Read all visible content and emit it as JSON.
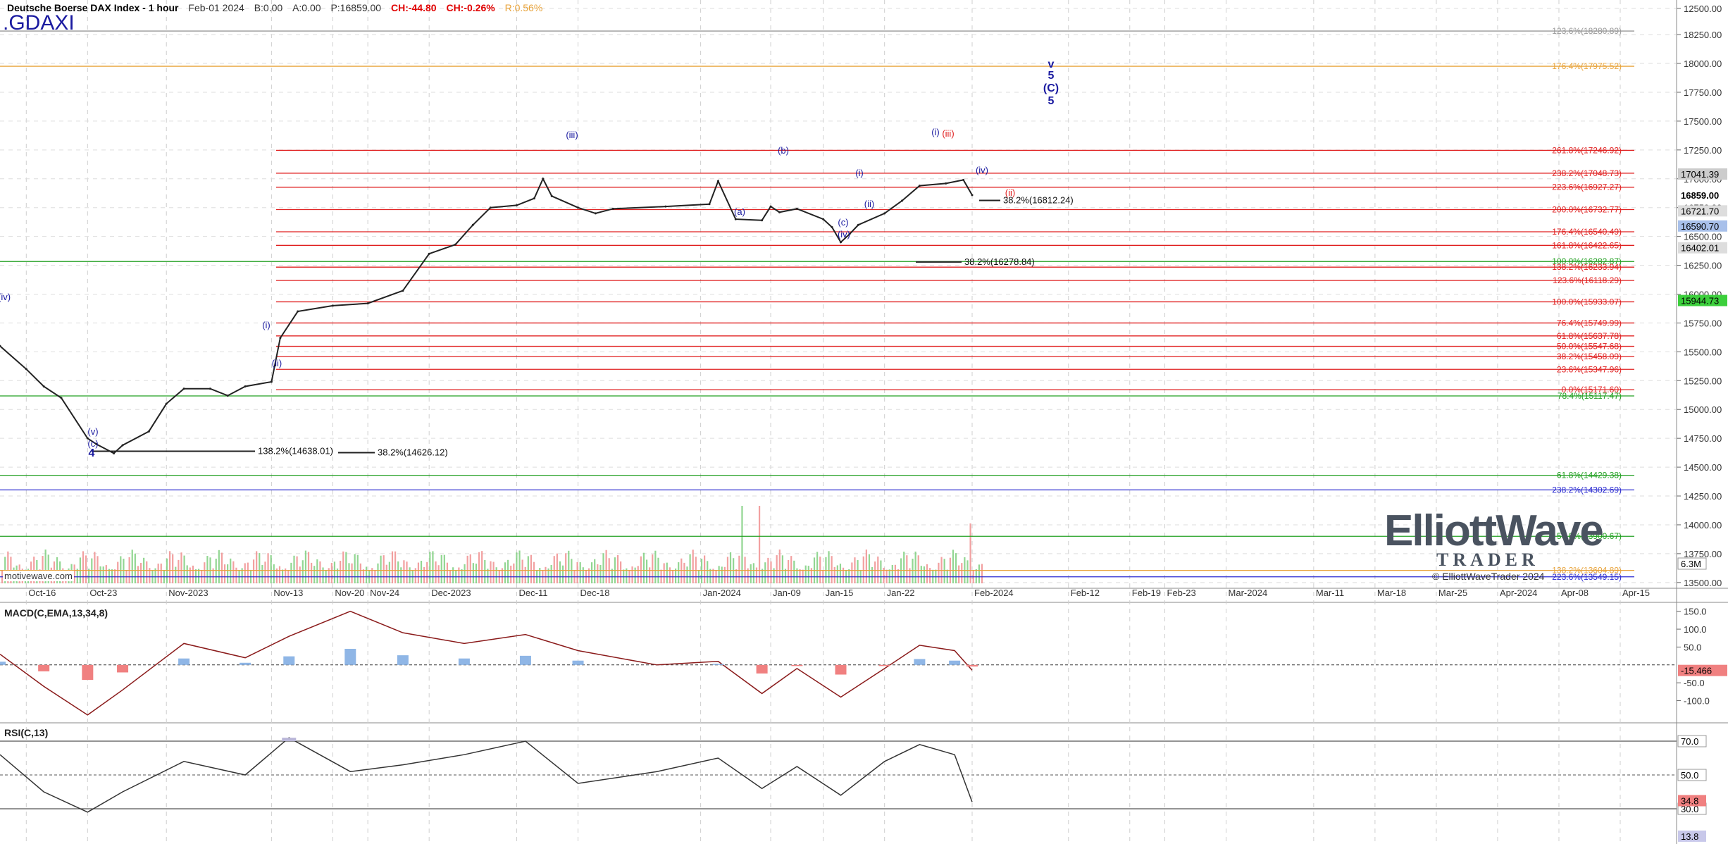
{
  "header": {
    "title": "Deutsche Boerse DAX Index - 1 hour",
    "date": "Feb-01 2024",
    "bid": "B:0.00",
    "ask": "A:0.00",
    "price": "P:16859.00",
    "change": "CH:-44.80",
    "change_pct": "CH:-0.26%",
    "range": "R:0.56%",
    "symbol": ".GDAXI",
    "brand": "motivewave.com"
  },
  "logo": {
    "main": "ElliottWave",
    "sub": "TRADER",
    "copyright": "© ElliottWaveTrader 2024"
  },
  "colors": {
    "up_price": "#222222",
    "fib_red": "#e02020",
    "fib_green": "#22a022",
    "fib_blue": "#2a2ad0",
    "fib_orange": "#e8a33a",
    "volume_green": "#7fcf7f",
    "volume_red": "#f08f8f",
    "macd_hist_blue": "#8fb6e6",
    "macd_hist_red": "#f08080",
    "rsi_fill": "#b9b6d8",
    "wave_blue": "#1a1aa0"
  },
  "chart_data": [
    {
      "type": "line",
      "title": "Deutsche Boerse DAX Index - 1 hour",
      "ylim": [
        13450,
        18550
      ],
      "y_ticks": [
        "12500.00",
        "18250.00",
        "18000.00",
        "17750.00",
        "17500.00",
        "17250.00",
        "17000.00",
        "16750.00",
        "16500.00",
        "16250.00",
        "16000.00",
        "15750.00",
        "15500.00",
        "15250.00",
        "15000.00",
        "14750.00",
        "14500.00",
        "14250.00",
        "14000.00",
        "13750.00",
        "13500.00"
      ],
      "x_ticks": [
        "Oct-16",
        "Oct-23",
        "Nov-2023",
        "Nov-13",
        "Nov-20",
        "Nov-24",
        "Dec-2023",
        "Dec-11",
        "Dec-18",
        "Jan-2024",
        "Jan-09",
        "Jan-15",
        "Jan-22",
        "Feb-2024",
        "Feb-12",
        "Feb-19",
        "Feb-23",
        "Mar-2024",
        "Mar-11",
        "Mar-18",
        "Mar-25",
        "Apr-2024",
        "Apr-08",
        "Apr-15"
      ],
      "series": [
        {
          "name": "price",
          "x": [
            "Oct-13",
            "Oct-16",
            "Oct-18",
            "Oct-20",
            "Oct-23",
            "Oct-24",
            "Oct-26",
            "Oct-27",
            "Oct-30",
            "Nov-01",
            "Nov-03",
            "Nov-06",
            "Nov-08",
            "Nov-10",
            "Nov-13",
            "Nov-14",
            "Nov-16",
            "Nov-20",
            "Nov-24",
            "Nov-28",
            "Dec-01",
            "Dec-04",
            "Dec-06",
            "Dec-08",
            "Dec-11",
            "Dec-13",
            "Dec-14",
            "Dec-15",
            "Dec-18",
            "Dec-20",
            "Dec-22",
            "Dec-28",
            "Jan-02",
            "Jan-03",
            "Jan-05",
            "Jan-08",
            "Jan-09",
            "Jan-10",
            "Jan-12",
            "Jan-15",
            "Jan-16",
            "Jan-17",
            "Jan-18",
            "Jan-19",
            "Jan-22",
            "Jan-24",
            "Jan-26",
            "Jan-29",
            "Jan-31",
            "Feb-01"
          ],
          "values": [
            15550,
            15350,
            15200,
            15100,
            14750,
            14700,
            14620,
            14690,
            14810,
            15050,
            15180,
            15180,
            15120,
            15200,
            15240,
            15620,
            15850,
            15900,
            15920,
            16030,
            16350,
            16430,
            16600,
            16750,
            16770,
            16830,
            17000,
            16850,
            16750,
            16700,
            16740,
            16760,
            16780,
            16980,
            16650,
            16640,
            16760,
            16710,
            16740,
            16650,
            16580,
            16450,
            16520,
            16600,
            16700,
            16810,
            16940,
            16960,
            16990,
            16859
          ]
        }
      ],
      "price_labels": [
        "17041.39",
        "16859.00",
        "16721.70",
        "16590.70",
        "16402.01",
        "15944.73"
      ],
      "fib_levels": [
        {
          "label": "123.6%(18280.89)",
          "value": 18280.89,
          "color": "#999999"
        },
        {
          "label": "176.4%(17975.52)",
          "value": 17975.52,
          "color": "#e8a33a"
        },
        {
          "label": "261.8%(17246.92)",
          "value": 17246.92,
          "color": "#e02020"
        },
        {
          "label": "238.2%(17048.73)",
          "value": 17048.73,
          "color": "#e02020"
        },
        {
          "label": "223.6%(16927.27)",
          "value": 16927.27,
          "color": "#e02020"
        },
        {
          "label": "200.0%(16732.77)",
          "value": 16732.77,
          "color": "#e02020"
        },
        {
          "label": "176.4%(16540.49)",
          "value": 16540.49,
          "color": "#e02020"
        },
        {
          "label": "161.8%(16422.65)",
          "value": 16422.65,
          "color": "#e02020"
        },
        {
          "label": "100.0%(16282.87)",
          "value": 16282.87,
          "color": "#22a022"
        },
        {
          "label": "138.2%(16233.94)",
          "value": 16233.94,
          "color": "#e02020"
        },
        {
          "label": "123.6%(16118.29)",
          "value": 16118.29,
          "color": "#e02020"
        },
        {
          "label": "100.0%(15933.07)",
          "value": 15933.07,
          "color": "#e02020"
        },
        {
          "label": "76.4%(15749.99)",
          "value": 15749.99,
          "color": "#e02020"
        },
        {
          "label": "61.8%(15637.78)",
          "value": 15637.78,
          "color": "#e02020"
        },
        {
          "label": "50.0%(15547.68)",
          "value": 15547.68,
          "color": "#e02020"
        },
        {
          "label": "38.2%(15458.09)",
          "value": 15458.09,
          "color": "#e02020"
        },
        {
          "label": "23.6%(15347.96)",
          "value": 15347.96,
          "color": "#e02020"
        },
        {
          "label": "0.0%(15171.60)",
          "value": 15171.6,
          "color": "#e02020"
        },
        {
          "label": "78.4%(15117.47)",
          "value": 15117.47,
          "color": "#22a022"
        },
        {
          "label": "61.8%(14429.38)",
          "value": 14429.38,
          "color": "#22a022"
        },
        {
          "label": "238.2%(14302.69)",
          "value": 14302.69,
          "color": "#2a2ad0"
        },
        {
          "label": "50.0%(13900.67)",
          "value": 13900.67,
          "color": "#22a022"
        },
        {
          "label": "138.2%(13604.89)",
          "value": 13604.89,
          "color": "#e8a33a"
        },
        {
          "label": "223.6%(13549.15)",
          "value": 13549.15,
          "color": "#2a2ad0"
        }
      ],
      "fib_annotations": [
        {
          "label": "38.2%(16812.24)",
          "value": 16812.24
        },
        {
          "label": "38.2%(16278.84)",
          "value": 16278.84
        },
        {
          "label": "138.2%(14638.01)",
          "value": 14638.01
        },
        {
          "label": "38.2%(14626.12)",
          "value": 14626.12
        }
      ],
      "wave_labels": [
        "v",
        "5",
        "(C)",
        "5",
        "(iii)",
        "(a)",
        "(b)",
        "(c)",
        "(iv)",
        "(i)",
        "(ii)",
        "(i)",
        "(iii)",
        "(iv)",
        "(ii)",
        "(iv)",
        "(i)",
        "(ii)",
        "(v)",
        "(c)",
        "4"
      ],
      "volume_label": "6.3M",
      "grid": true
    },
    {
      "type": "line",
      "title": "MACD(C,EMA,13,34,8)",
      "ylim": [
        -160,
        175
      ],
      "y_ticks": [
        "150.0",
        "100.0",
        "50.0",
        "-50.0",
        "-100.0"
      ],
      "series": [
        {
          "name": "MACD",
          "x": [
            "Oct-13",
            "Oct-18",
            "Oct-23",
            "Oct-27",
            "Nov-03",
            "Nov-10",
            "Nov-15",
            "Nov-22",
            "Nov-28",
            "Dec-05",
            "Dec-12",
            "Dec-18",
            "Dec-27",
            "Jan-03",
            "Jan-08",
            "Jan-12",
            "Jan-17",
            "Jan-22",
            "Jan-26",
            "Jan-30",
            "Feb-01"
          ],
          "values": [
            30,
            -60,
            -140,
            -70,
            60,
            20,
            80,
            150,
            90,
            60,
            85,
            40,
            0,
            10,
            -80,
            -10,
            -90,
            -10,
            55,
            40,
            -15
          ]
        }
      ],
      "current_value": "-15.466"
    },
    {
      "type": "line",
      "title": "RSI(C,13)",
      "ylim": [
        10,
        80
      ],
      "y_ticks": [
        "70.0",
        "50.0",
        "30.0"
      ],
      "series": [
        {
          "name": "RSI",
          "x": [
            "Oct-13",
            "Oct-18",
            "Oct-23",
            "Oct-27",
            "Nov-03",
            "Nov-10",
            "Nov-15",
            "Nov-22",
            "Nov-28",
            "Dec-05",
            "Dec-12",
            "Dec-18",
            "Dec-27",
            "Jan-03",
            "Jan-08",
            "Jan-12",
            "Jan-17",
            "Jan-22",
            "Jan-26",
            "Jan-30",
            "Feb-01"
          ],
          "values": [
            62,
            40,
            28,
            40,
            58,
            50,
            72,
            52,
            56,
            62,
            70,
            45,
            52,
            60,
            42,
            55,
            38,
            58,
            68,
            62,
            34
          ]
        }
      ],
      "current_values": [
        "34.8",
        "13.8"
      ]
    }
  ]
}
